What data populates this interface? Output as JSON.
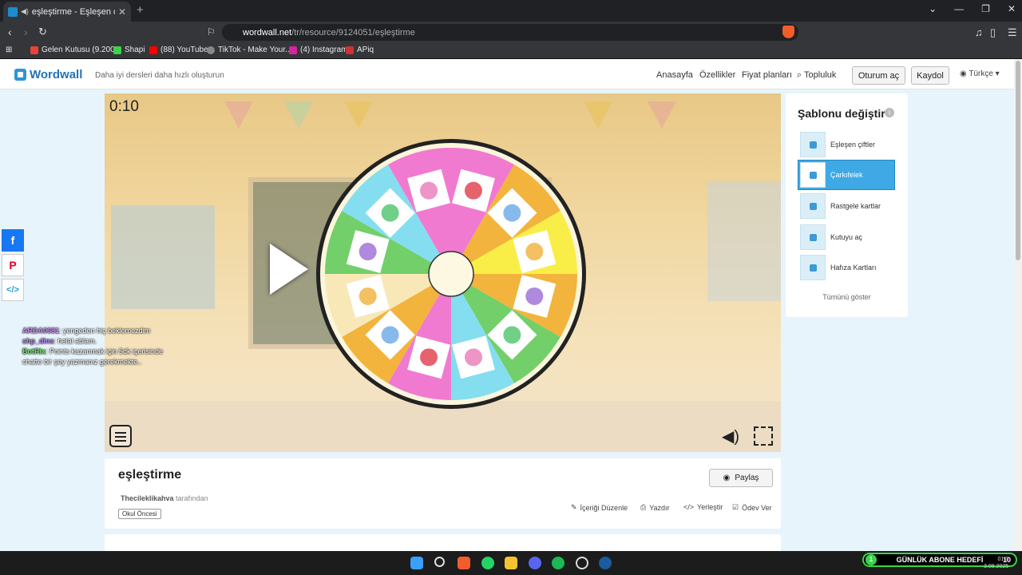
{
  "browser": {
    "tab_title": "eşleştirme - Eşleşen çiftler",
    "url_host": "wordwall.net",
    "url_path": "/tr/resource/9124051/eşleştirme",
    "bookmarks": [
      "Gelen Kutusu (9.200...",
      "Shapi",
      "(88) YouTube",
      "TikTok - Make Your...",
      "(4) Instagram",
      "APiq"
    ]
  },
  "header": {
    "logo": "Wordwall",
    "tagline": "Daha iyi dersleri daha hızlı oluşturun",
    "nav": [
      "Anasayfa",
      "Özellikler",
      "Fiyat planları",
      "Topluluk"
    ],
    "login": "Oturum aç",
    "signup": "Kaydol",
    "language": "Türkçe"
  },
  "game": {
    "timer": "0:10",
    "segment_colors": [
      "#f07ad0",
      "#f2b43c",
      "#f9ee48",
      "#f2b43c",
      "#72cf6a",
      "#84def0",
      "#f07ad0",
      "#f2b43c",
      "#f8e8b8",
      "#72cf6a",
      "#84def0",
      "#f07ad0"
    ]
  },
  "chat": [
    {
      "user": "ARDA0681",
      "text": ": yengeden hiç beklemezdim"
    },
    {
      "user": "shp_dins",
      "text": ": helal ablam."
    },
    {
      "user": "BotRix",
      "text": ": Points kazanmak için 5dk içerisinde chatte bir şey yazmanız gerekmekte.."
    }
  ],
  "sidebar": {
    "title": "Şablonu değiştir",
    "templates": [
      "Eşleşen çiftler",
      "Çarkıfelek",
      "Rastgele kartlar",
      "Kutuyu aç",
      "Hafıza Kartları"
    ],
    "selected": "Çarkıfelek",
    "show_all": "Tümünü göster"
  },
  "resource": {
    "title": "eşleştirme",
    "author": "Thecileklikahva",
    "author_suffix": "tarafından",
    "tag": "Okul Öncesi",
    "share": "Paylaş",
    "actions": [
      "İçeriği Düzenle",
      "Yazdır",
      "Yerleştir",
      "Ödev Ver"
    ]
  },
  "taskbar": {
    "overlay_text": "GÜNLÜK ABONE HEDEFİ",
    "overlay_count": "10",
    "clock_time": "01:3",
    "clock_date": "3.08.2025"
  }
}
